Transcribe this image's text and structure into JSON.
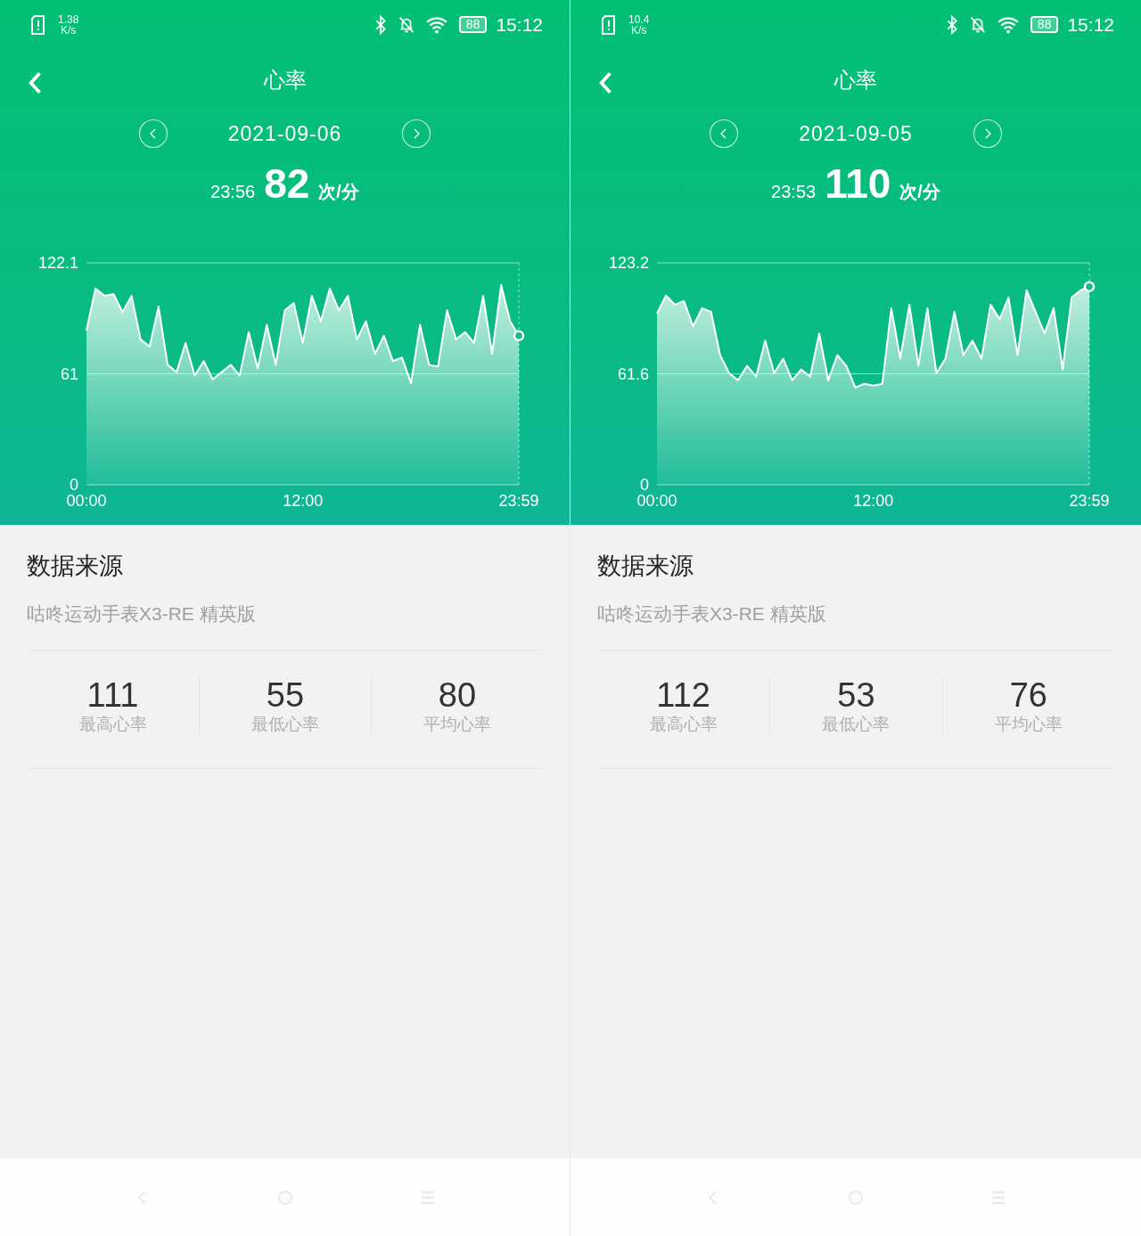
{
  "screens": [
    {
      "status_bar": {
        "speed": "1.38",
        "speed_unit": "K/s",
        "battery": "88",
        "time": "15:12"
      },
      "title": "心率",
      "date": "2021-09-06",
      "reading": {
        "time": "23:56",
        "value": "82",
        "unit": "次/分"
      },
      "chart_data": {
        "type": "area",
        "x": [
          0,
          0.5,
          1,
          1.5,
          2,
          2.5,
          3,
          3.5,
          4,
          4.5,
          5,
          5.5,
          6,
          6.5,
          7,
          7.5,
          8,
          8.5,
          9,
          9.5,
          10,
          10.5,
          11,
          11.5,
          12,
          12.5,
          13,
          13.5,
          14,
          14.5,
          15,
          15.5,
          16,
          16.5,
          17,
          17.5,
          18,
          18.5,
          19,
          19.5,
          20,
          20.5,
          21,
          21.5,
          22,
          22.5,
          23,
          23.5,
          23.98
        ],
        "series": [
          {
            "color": "#ffffff",
            "values": [
              85,
              108,
              104,
              105,
              95,
              104,
              80,
              76,
              98,
              66,
              62,
              78,
              60,
              68,
              58,
              62,
              66,
              60,
              84,
              64,
              88,
              66,
              96,
              100,
              78,
              104,
              90,
              108,
              96,
              104,
              80,
              90,
              72,
              82,
              68,
              70,
              56,
              88,
              66,
              65,
              96,
              80,
              84,
              78,
              104,
              72,
              110,
              90,
              82
            ]
          }
        ],
        "xlim": [
          0,
          23.98
        ],
        "ylim": [
          0,
          122.1
        ],
        "xticks": [
          {
            "value": 0,
            "label": "00:00"
          },
          {
            "value": 12,
            "label": "12:00"
          },
          {
            "value": 23.98,
            "label": "23:59"
          }
        ],
        "yticks": [
          {
            "value": 0,
            "label": "0"
          },
          {
            "value": 61,
            "label": "61"
          },
          {
            "value": 122.1,
            "label": "122.1"
          }
        ]
      },
      "source": {
        "heading": "数据来源",
        "device": "咕咚运动手表X3-RE 精英版"
      },
      "stats": [
        {
          "value": "111",
          "label": "最高心率"
        },
        {
          "value": "55",
          "label": "最低心率"
        },
        {
          "value": "80",
          "label": "平均心率"
        }
      ]
    },
    {
      "status_bar": {
        "speed": "10.4",
        "speed_unit": "K/s",
        "battery": "88",
        "time": "15:12"
      },
      "title": "心率",
      "date": "2021-09-05",
      "reading": {
        "time": "23:53",
        "value": "110",
        "unit": "次/分"
      },
      "chart_data": {
        "type": "area",
        "x": [
          0,
          0.5,
          1,
          1.5,
          2,
          2.5,
          3,
          3.5,
          4,
          4.5,
          5,
          5.5,
          6,
          6.5,
          7,
          7.5,
          8,
          8.5,
          9,
          9.5,
          10,
          10.5,
          11,
          11.5,
          12,
          12.5,
          13,
          13.5,
          14,
          14.5,
          15,
          15.5,
          16,
          16.5,
          17,
          17.5,
          18,
          18.5,
          19,
          19.5,
          20,
          20.5,
          21,
          21.5,
          22,
          22.5,
          23,
          23.5,
          23.98
        ],
        "series": [
          {
            "color": "#ffffff",
            "values": [
              95,
              105,
              100,
              102,
              88,
              98,
              96,
              72,
              62,
              58,
              66,
              60,
              80,
              62,
              70,
              58,
              64,
              60,
              84,
              58,
              72,
              66,
              54,
              56,
              55,
              56,
              98,
              70,
              100,
              66,
              98,
              62,
              70,
              96,
              72,
              80,
              70,
              100,
              92,
              104,
              72,
              108,
              96,
              84,
              98,
              64,
              104,
              108,
              110
            ]
          }
        ],
        "xlim": [
          0,
          23.98
        ],
        "ylim": [
          0,
          123.2
        ],
        "xticks": [
          {
            "value": 0,
            "label": "00:00"
          },
          {
            "value": 12,
            "label": "12:00"
          },
          {
            "value": 23.98,
            "label": "23:59"
          }
        ],
        "yticks": [
          {
            "value": 0,
            "label": "0"
          },
          {
            "value": 61.6,
            "label": "61.6"
          },
          {
            "value": 123.2,
            "label": "123.2"
          }
        ]
      },
      "source": {
        "heading": "数据来源",
        "device": "咕咚运动手表X3-RE 精英版"
      },
      "stats": [
        {
          "value": "112",
          "label": "最高心率"
        },
        {
          "value": "53",
          "label": "最低心率"
        },
        {
          "value": "76",
          "label": "平均心率"
        }
      ]
    }
  ]
}
